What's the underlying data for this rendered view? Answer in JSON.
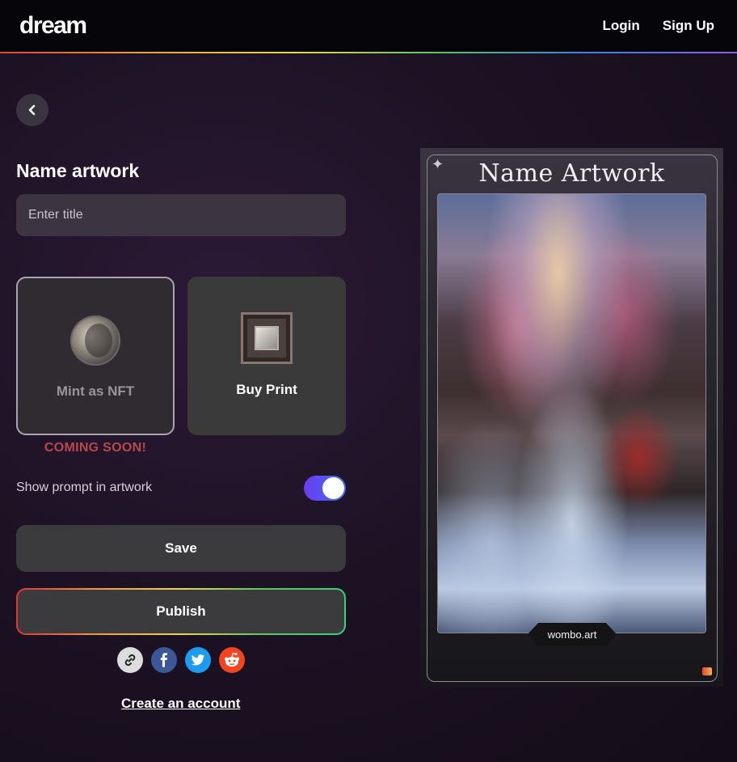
{
  "header": {
    "logo": "dream",
    "login": "Login",
    "signup": "Sign Up"
  },
  "form": {
    "section_title": "Name artwork",
    "title_placeholder": "Enter title",
    "options": {
      "nft_label": "Mint as NFT",
      "print_label": "Buy Print",
      "coming_soon": "COMING SOON!"
    },
    "toggle_label": "Show prompt in artwork",
    "toggle_on": true,
    "save_label": "Save",
    "publish_label": "Publish",
    "create_account": "Create an account"
  },
  "preview": {
    "title": "Name Artwork",
    "badge": "wombo.art"
  },
  "colors": {
    "accent_toggle": "#4a5cf2",
    "coming_soon": "#b8484a",
    "facebook": "#3b5798",
    "twitter": "#1d9bf0",
    "reddit": "#f0451e"
  },
  "icons": [
    "chevron-left-icon",
    "nft-coin-icon",
    "print-frame-icon",
    "link-icon",
    "facebook-icon",
    "twitter-icon",
    "reddit-icon",
    "sparkle-icon",
    "wombo-logo-icon"
  ]
}
